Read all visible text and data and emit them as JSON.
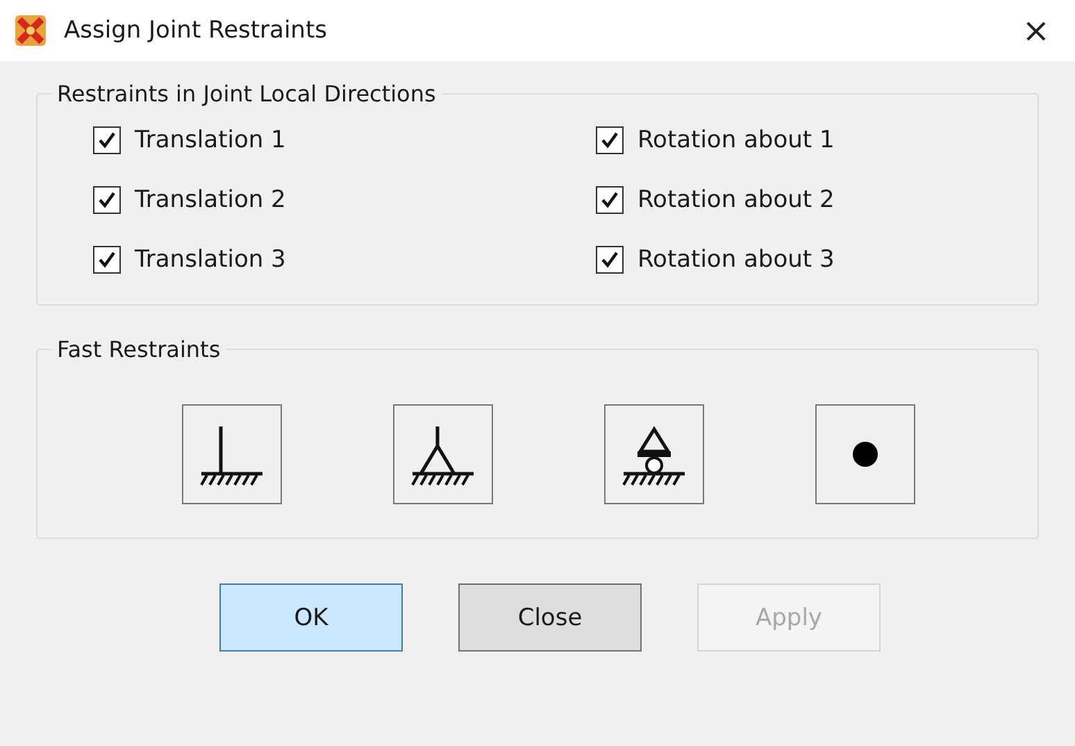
{
  "window": {
    "title": "Assign Joint Restraints",
    "close": "×"
  },
  "local_directions": {
    "title": "Restraints in Joint Local Directions",
    "items": [
      {
        "label": "Translation 1",
        "checked": true
      },
      {
        "label": "Rotation about 1",
        "checked": true
      },
      {
        "label": "Translation 2",
        "checked": true
      },
      {
        "label": "Rotation about 2",
        "checked": true
      },
      {
        "label": "Translation 3",
        "checked": true
      },
      {
        "label": "Rotation about 3",
        "checked": true
      }
    ]
  },
  "fast_restraints": {
    "title": "Fast Restraints",
    "buttons": [
      {
        "kind": "fixed"
      },
      {
        "kind": "pinned"
      },
      {
        "kind": "roller"
      },
      {
        "kind": "free"
      }
    ]
  },
  "buttons": [
    {
      "label": "OK",
      "default": true,
      "disabled": false
    },
    {
      "label": "Close",
      "default": false,
      "disabled": false
    },
    {
      "label": "Apply",
      "default": false,
      "disabled": true
    }
  ]
}
